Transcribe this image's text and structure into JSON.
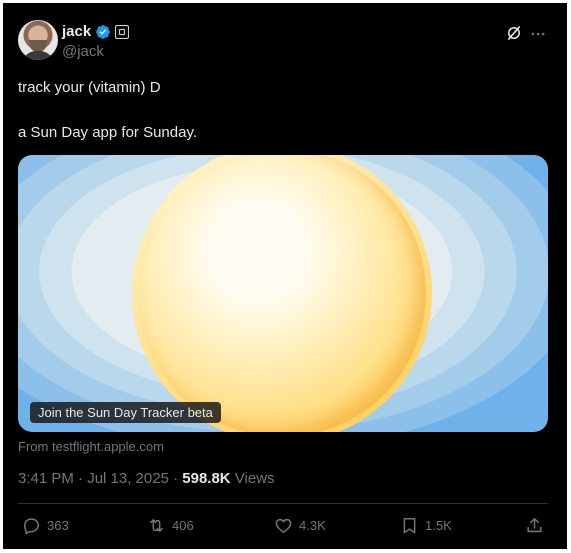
{
  "author": {
    "name": "jack",
    "handle": "@jack"
  },
  "tweet": {
    "line1": "track your (vitamin) D",
    "line2": "a Sun Day app for Sunday."
  },
  "card": {
    "cta": "Join the Sun Day Tracker beta",
    "source": "From testflight.apple.com"
  },
  "meta": {
    "datetime": "3:41 PM · Jul 13, 2025 · ",
    "views_count": "598.8K",
    "views_label": " Views"
  },
  "actions": {
    "replies": "363",
    "reposts": "406",
    "likes": "4.3K",
    "bookmarks": "1.5K"
  },
  "colors": {
    "background": "#000000",
    "text": "#e7e9ea",
    "muted": "#71767b",
    "verified": "#1d9bf0"
  },
  "icons": [
    "verified-badge-icon",
    "affiliate-badge-icon",
    "grok-icon",
    "more-icon",
    "reply-icon",
    "repost-icon",
    "like-icon",
    "bookmark-icon",
    "share-icon"
  ]
}
